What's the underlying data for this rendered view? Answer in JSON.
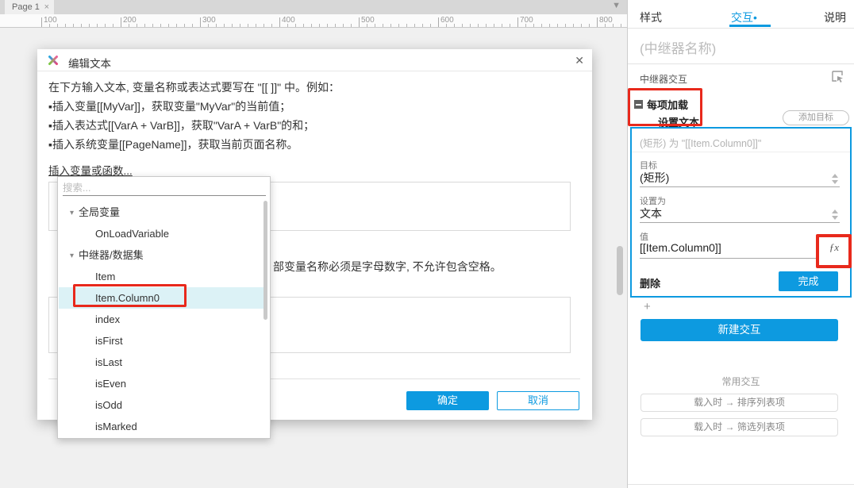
{
  "colors": {
    "accent": "#0d9ae0",
    "annotation": "#e8291c",
    "selected_row": "#dcf2f6"
  },
  "tabbar": {
    "tab_label": "Page 1",
    "tab_close": "×",
    "overflow_icon": "▼"
  },
  "ruler": {
    "labels": [
      "100",
      "200",
      "300",
      "400",
      "500",
      "600",
      "700",
      "800"
    ]
  },
  "dialog": {
    "title": "编辑文本",
    "close": "✕",
    "instructions": [
      "在下方输入文本, 变量名称或表达式要写在 \"[[ ]]\" 中。例如：",
      "▪插入变量[[MyVar]]，获取变量\"MyVar\"的当前值；",
      "▪插入表达式[[VarA + VarB]]，获取\"VarA + VarB\"的和；",
      "▪插入系统变量[[PageName]]，获取当前页面名称。"
    ],
    "insert_link": "插入变量或函数...",
    "note_visible_fragment": "部变量名称必须是字母数字, 不允许包含空格。",
    "ok": "确定",
    "cancel": "取消"
  },
  "dropdown": {
    "search_placeholder": "搜索...",
    "tree_icon": "▾",
    "items": [
      {
        "label": "全局变量",
        "type": "group"
      },
      {
        "label": "OnLoadVariable",
        "type": "item"
      },
      {
        "label": "中继器/数据集",
        "type": "group"
      },
      {
        "label": "Item",
        "type": "item"
      },
      {
        "label": "Item.Column0",
        "type": "item",
        "selected": true
      },
      {
        "label": "index",
        "type": "item"
      },
      {
        "label": "isFirst",
        "type": "item"
      },
      {
        "label": "isLast",
        "type": "item"
      },
      {
        "label": "isEven",
        "type": "item"
      },
      {
        "label": "isOdd",
        "type": "item"
      },
      {
        "label": "isMarked",
        "type": "item"
      }
    ]
  },
  "panel": {
    "tabs": [
      {
        "label": "样式"
      },
      {
        "label": "交互",
        "active": true,
        "dot": "•"
      },
      {
        "label": "说明"
      }
    ],
    "name_placeholder": "(中继器名称)",
    "section_label": "中继器交互",
    "event_label": "每项加载",
    "action_label": "设置文本",
    "add_target": "添加目标",
    "case_summary": "(矩形) 为 \"[[Item.Column0]]\"",
    "target_label": "目标",
    "target_value": "(矩形)",
    "set_to_label": "设置为",
    "set_to_value": "文本",
    "value_label": "值",
    "value_value": "[[Item.Column0]]",
    "fx_label": "ƒx",
    "delete_label": "删除",
    "done_label": "完成",
    "plus_label": "+",
    "new_interaction": "新建交互",
    "common_label": "常用交互",
    "common_actions": [
      "载入时 → 排序列表项",
      "载入时 → 筛选列表项"
    ]
  }
}
